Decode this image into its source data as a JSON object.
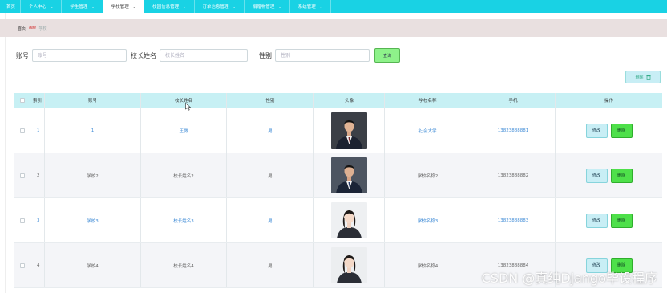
{
  "nav": {
    "items": [
      {
        "label": "首页",
        "has_caret": false,
        "active": false
      },
      {
        "label": "个人中心",
        "has_caret": true,
        "active": false
      },
      {
        "label": "学生管理",
        "has_caret": true,
        "active": false
      },
      {
        "label": "学校管理",
        "has_caret": true,
        "active": true
      },
      {
        "label": "校园信息管理",
        "has_caret": true,
        "active": false
      },
      {
        "label": "订单信息管理",
        "has_caret": true,
        "active": false
      },
      {
        "label": "捐赠物管理",
        "has_caret": true,
        "active": false
      },
      {
        "label": "系统管理",
        "has_caret": true,
        "active": false
      }
    ],
    "caret_glyph": "⌄"
  },
  "breadcrumb": {
    "home": "首页",
    "separator": "ɞɞɞ",
    "current": "学校"
  },
  "search": {
    "account_label": "账号",
    "account_placeholder": "账号",
    "principal_label": "校长姓名",
    "principal_placeholder": "校长姓名",
    "gender_label": "性别",
    "gender_placeholder": "性别",
    "query_button": "查询"
  },
  "toolbar": {
    "delete_label": "删除",
    "delete_icon": "trash-icon"
  },
  "table": {
    "headers": {
      "index": "索引",
      "account": "账号",
      "principal": "校长姓名",
      "gender": "性别",
      "avatar": "头像",
      "school": "学校名称",
      "phone": "手机",
      "ops": "操作"
    },
    "rows": [
      {
        "index": "1",
        "account": "1",
        "principal": "王微",
        "gender": "男",
        "avatar": "man-portrait",
        "school": "社会大学",
        "phone": "13823888881",
        "edit": "修改",
        "delete": "删除",
        "link_style": true
      },
      {
        "index": "2",
        "account": "学校2",
        "principal": "校长姓名2",
        "gender": "男",
        "avatar": "man-portrait",
        "school": "学校名称2",
        "phone": "13823888882",
        "edit": "修改",
        "delete": "删除",
        "link_style": false
      },
      {
        "index": "3",
        "account": "学校3",
        "principal": "校长姓名3",
        "gender": "男",
        "avatar": "woman-portrait",
        "school": "学校名称3",
        "phone": "13823888883",
        "edit": "修改",
        "delete": "删除",
        "link_style": true
      },
      {
        "index": "4",
        "account": "学校4",
        "principal": "校长姓名4",
        "gender": "男",
        "avatar": "woman-portrait",
        "school": "学校名称4",
        "phone": "13823888884",
        "edit": "修改",
        "delete": "删除",
        "link_style": false
      }
    ]
  },
  "watermark": "CSDN @真纯Django毕设程序",
  "colors": {
    "nav_bg": "#19d2e4",
    "header_row_bg": "#c7f0f4",
    "link_text": "#3f8bd6",
    "delete_btn": "#4ee04a",
    "edit_btn": "#c8eef5"
  }
}
